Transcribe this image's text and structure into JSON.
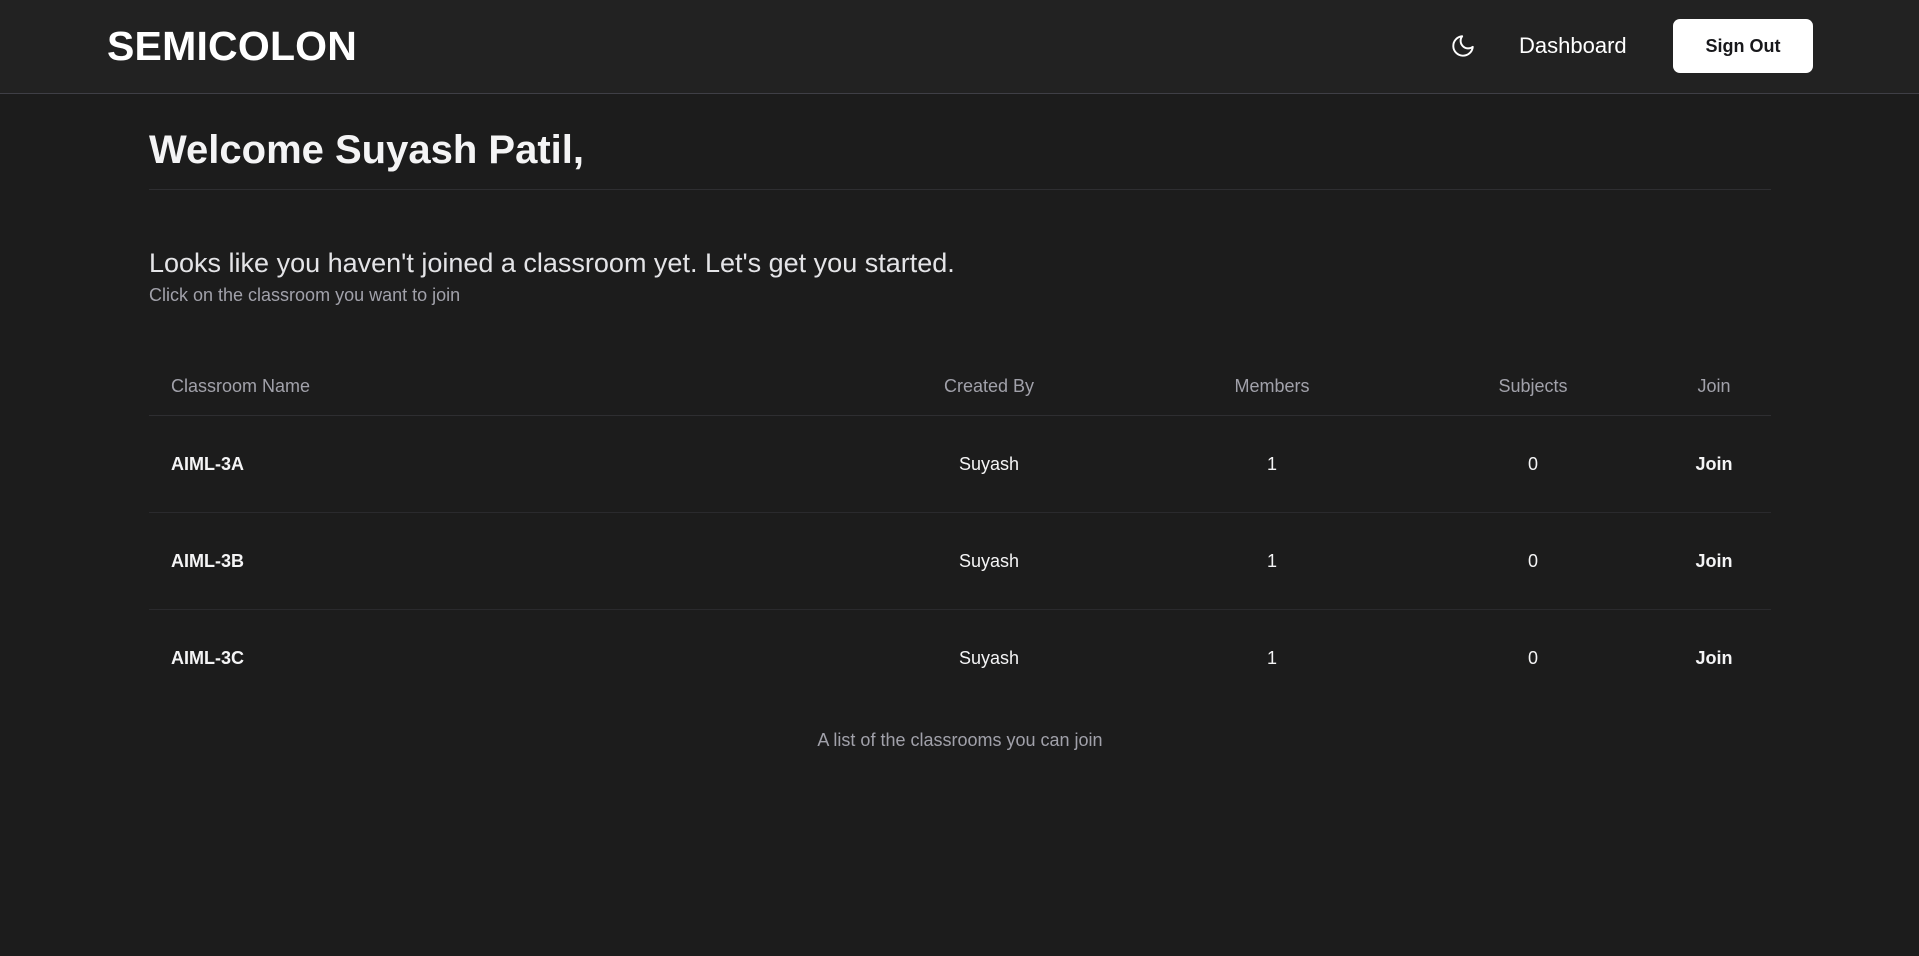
{
  "header": {
    "brand": "SEMICOLON",
    "theme_toggle_icon": "moon-icon",
    "nav_dashboard": "Dashboard",
    "sign_out_label": "Sign Out"
  },
  "main": {
    "welcome": "Welcome Suyash Patil,",
    "headline": "Looks like you haven't joined a classroom yet. Let's get you started.",
    "subline": "Click on the classroom you want to join",
    "table": {
      "columns": [
        "Classroom Name",
        "Created By",
        "Members",
        "Subjects",
        "Join"
      ],
      "rows": [
        {
          "name": "AIML-3A",
          "created_by": "Suyash",
          "members": "1",
          "subjects": "0",
          "join": "Join"
        },
        {
          "name": "AIML-3B",
          "created_by": "Suyash",
          "members": "1",
          "subjects": "0",
          "join": "Join"
        },
        {
          "name": "AIML-3C",
          "created_by": "Suyash",
          "members": "1",
          "subjects": "0",
          "join": "Join"
        }
      ],
      "caption": "A list of the classrooms you can join"
    }
  },
  "colors": {
    "page_bg": "#1c1c1c",
    "header_bg": "#222222",
    "button_bg": "#ffffff",
    "muted_text": "#a1a1aa"
  }
}
